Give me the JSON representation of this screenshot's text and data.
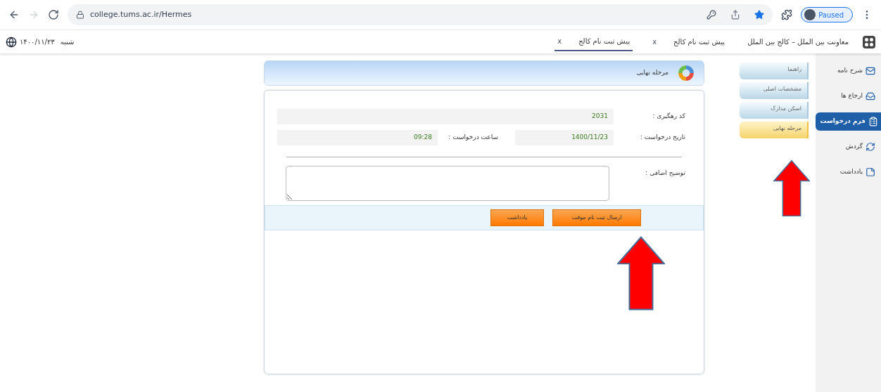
{
  "browser": {
    "url": "college.tums.ac.ir/Hermes",
    "profile": "Paused"
  },
  "app_bar": {
    "tabs": [
      {
        "label": "معاونت بین الملل – کالج بین الملل",
        "selected": false
      },
      {
        "label": "پیش ثبت نام کالج",
        "close": "x",
        "selected": false
      },
      {
        "label": "پیش ثبت نام کالج",
        "close": "x",
        "selected": true
      }
    ],
    "day": "شنبه",
    "date": "۱۴۰۰/۱۱/۲۳"
  },
  "sidebar": {
    "items": [
      {
        "label": "شرح نامه",
        "selected": false
      },
      {
        "label": "ارجاع ها",
        "selected": false
      },
      {
        "label": "فرم درخواست",
        "selected": true
      },
      {
        "label": "گردش",
        "selected": false
      },
      {
        "label": "یادداشت",
        "selected": false
      }
    ]
  },
  "steps": [
    {
      "label": "راهنما",
      "selected": false
    },
    {
      "label": "مشخصات اصلی",
      "selected": false
    },
    {
      "label": "اسکن مدارک",
      "selected": false
    },
    {
      "label": "مرحله نهایی",
      "selected": true
    }
  ],
  "panel": {
    "title": "مرحله نهایی",
    "tracking": {
      "label": "کد رهگیری :",
      "value": "2031"
    },
    "request_date": {
      "label": "تاریخ درخواست :",
      "value": "1400/11/23"
    },
    "request_time": {
      "label": "ساعت درخواست :",
      "value": "09:28"
    },
    "notes": {
      "label": "توضیح اضافی :"
    },
    "buttons": [
      "ارسال ثبت نام موقت",
      "یادداشت"
    ]
  },
  "annotations": [
    {
      "kind": "arrow"
    },
    {
      "kind": "arrow"
    }
  ]
}
